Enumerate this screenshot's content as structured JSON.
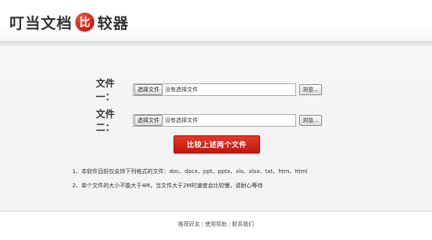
{
  "header": {
    "logo_left": "叮当文档",
    "logo_badge": "比",
    "logo_right": "较器"
  },
  "form": {
    "file1_label": "文件一：",
    "file2_label": "文件二：",
    "choose_label": "选择文件",
    "no_file_text": "没有选择文件",
    "browse_label": "浏览..."
  },
  "compare_button": "比较上述两个文件",
  "notes": [
    "1、本软件目前仅支持下列格式的文件：doc、docx、ppt、pptx、xls、xlsx、txt、htm、html",
    "2、单个文件的大小不能大于4M，当文件大于2M时速度会比较慢，请耐心等待"
  ],
  "footer": {
    "links": [
      "推荐好友",
      "使用帮助",
      "联系我们"
    ],
    "separator": "|"
  },
  "colors": {
    "accent": "#c81d12",
    "button_top": "#e03a2c",
    "button_bottom": "#c2160c"
  }
}
